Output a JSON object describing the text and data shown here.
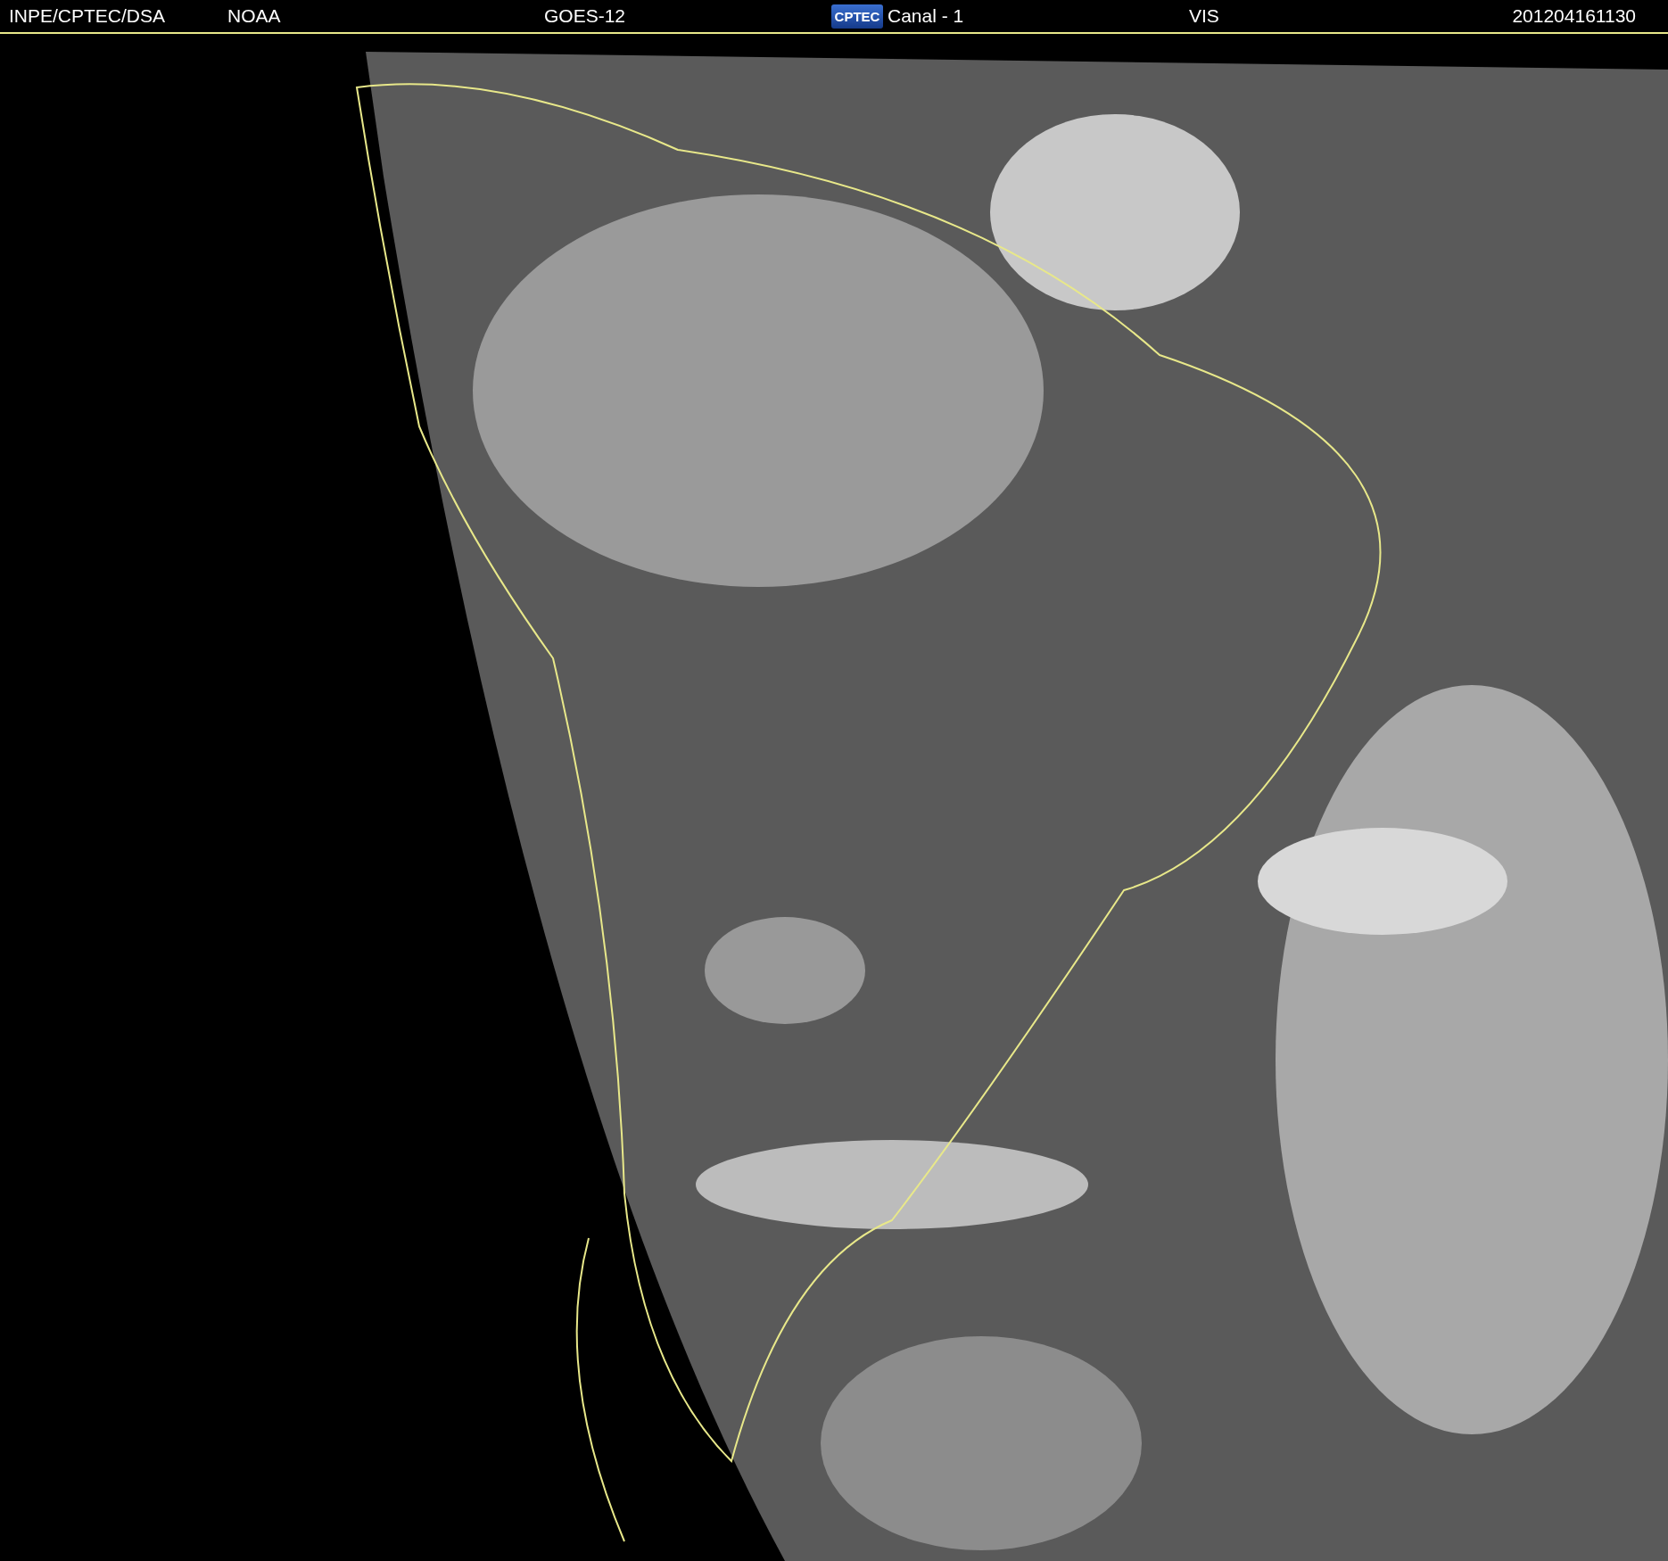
{
  "header": {
    "source": "INPE/CPTEC/DSA",
    "agency": "NOAA",
    "satellite": "GOES-12",
    "logo": "CPTEC",
    "channel": "Canal - 1",
    "band": "VIS",
    "timestamp": "201204161130"
  }
}
